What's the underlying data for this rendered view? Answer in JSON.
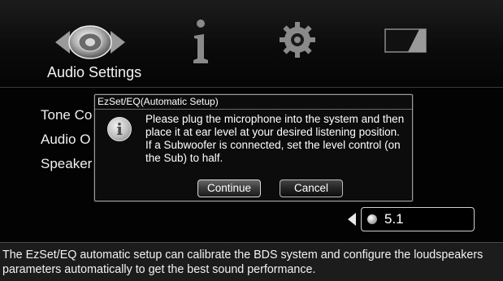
{
  "header": {
    "title": "Audio Settings",
    "icons": [
      "speaker-icon",
      "info-icon",
      "gear-icon",
      "display-icon"
    ]
  },
  "menu": {
    "items": [
      "Tone Co",
      "Audio O",
      "Speaker"
    ]
  },
  "selector": {
    "value": "5.1"
  },
  "dialog": {
    "title": "EzSet/EQ(Automatic Setup)",
    "message": "Please plug the microphone into the system and then place it at ear level at your desired listening position. If a Subwoofer is connected, set the level control (on the Sub) to half.",
    "icon_glyph": "i",
    "continue_label": "Continue",
    "cancel_label": "Cancel"
  },
  "footer": {
    "help_text": "The EzSet/EQ automatic setup can calibrate the BDS system and configure the loudspeakers parameters automatically to get the best sound performance."
  },
  "colors": {
    "background": "#000000",
    "footer_bg": "#1c1c1c",
    "text": "#ffffff",
    "border": "#9a9a9a"
  }
}
